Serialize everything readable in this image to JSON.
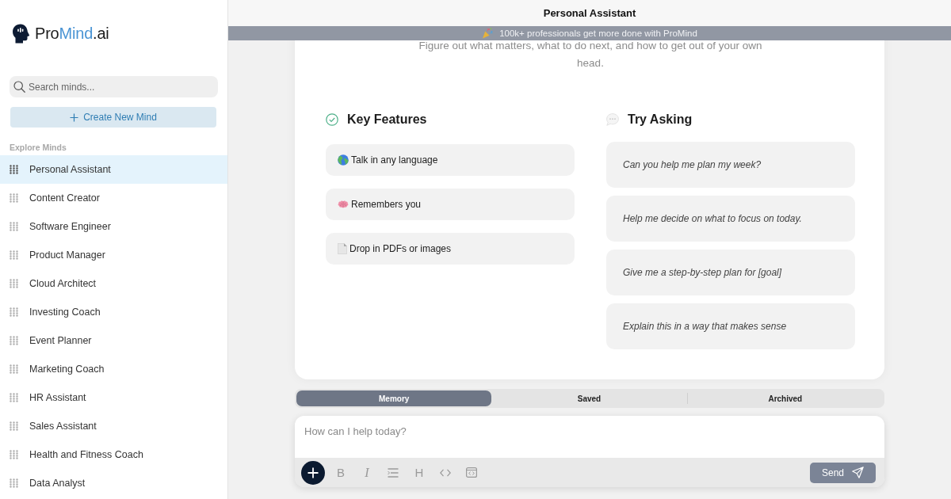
{
  "sidebar": {
    "logo": {
      "prefix": "Pro",
      "accent": "Mind",
      "suffix": ".ai"
    },
    "search": {
      "placeholder": "Search minds..."
    },
    "create_button": {
      "label": "Create New Mind"
    },
    "section_label": "Explore Minds",
    "items": [
      {
        "label": "Personal Assistant",
        "selected": true
      },
      {
        "label": "Content Creator",
        "selected": false
      },
      {
        "label": "Software Engineer",
        "selected": false
      },
      {
        "label": "Product Manager",
        "selected": false
      },
      {
        "label": "Cloud Architect",
        "selected": false
      },
      {
        "label": "Investing Coach",
        "selected": false
      },
      {
        "label": "Event Planner",
        "selected": false
      },
      {
        "label": "Marketing Coach",
        "selected": false
      },
      {
        "label": "HR Assistant",
        "selected": false
      },
      {
        "label": "Sales Assistant",
        "selected": false
      },
      {
        "label": "Health and Fitness Coach",
        "selected": false
      },
      {
        "label": "Data Analyst",
        "selected": false
      }
    ]
  },
  "header": {
    "title": "Personal Assistant"
  },
  "banner": {
    "text": "100k+ professionals get more done with ProMind"
  },
  "intro": {
    "subtitle": "Figure out what matters, what to do next, and how to get out of your own head."
  },
  "features": {
    "title": "Key Features",
    "items": [
      "Talk in any language",
      "Remembers you",
      "Drop in PDFs or images"
    ]
  },
  "try_asking": {
    "title": "Try Asking",
    "prompts": [
      "Can you help me plan my week?",
      "Help me decide on what to focus on today.",
      "Give me a step-by-step plan for [goal]",
      "Explain this in a way that makes sense"
    ]
  },
  "tabs": [
    {
      "label": "Memory",
      "selected": true
    },
    {
      "label": "Saved",
      "selected": false
    },
    {
      "label": "Archived",
      "selected": false
    }
  ],
  "composer": {
    "placeholder": "How can I help today?",
    "toolbar": [
      {
        "kind": "bold",
        "label": "B"
      },
      {
        "kind": "italic",
        "label": "I"
      },
      {
        "kind": "list"
      },
      {
        "kind": "heading",
        "label": "H"
      },
      {
        "kind": "code"
      },
      {
        "kind": "embed"
      }
    ],
    "send_label": "Send"
  }
}
